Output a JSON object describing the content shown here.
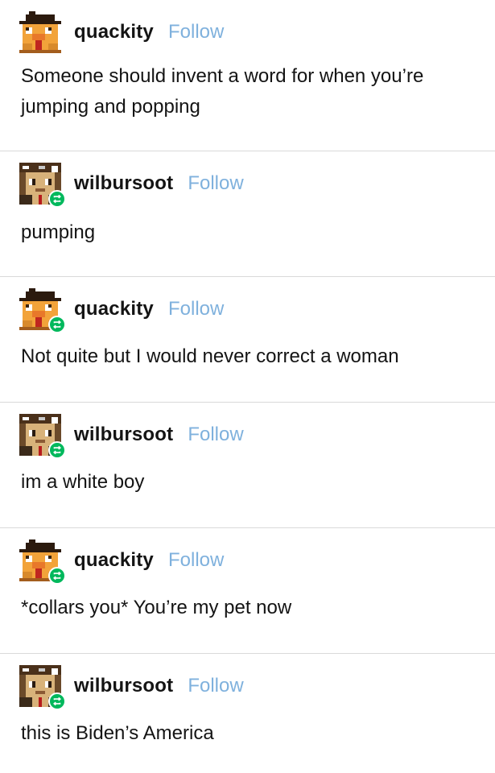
{
  "posts": [
    {
      "username": "quackity",
      "follow_label": "Follow",
      "text": "Someone should invent a word for when you’re jumping and popping",
      "avatar": "quackity-avatar",
      "reblog": false
    },
    {
      "username": "wilbursoot",
      "follow_label": "Follow",
      "text": "pumping",
      "avatar": "wilbursoot-avatar",
      "reblog": true
    },
    {
      "username": "quackity",
      "follow_label": "Follow",
      "text": "Not quite but I would never correct a woman",
      "avatar": "quackity-avatar",
      "reblog": true
    },
    {
      "username": "wilbursoot",
      "follow_label": "Follow",
      "text": "im a white boy",
      "avatar": "wilbursoot-avatar",
      "reblog": true
    },
    {
      "username": "quackity",
      "follow_label": "Follow",
      "text": "*collars you* You’re my pet now",
      "avatar": "quackity-avatar",
      "reblog": true
    },
    {
      "username": "wilbursoot",
      "follow_label": "Follow",
      "text": "this is Biden’s America",
      "avatar": "wilbursoot-avatar",
      "reblog": true
    }
  ],
  "colors": {
    "follow": "#7fb1dd",
    "reblog_badge": "#00b85c",
    "divider": "#d9d9d9"
  }
}
